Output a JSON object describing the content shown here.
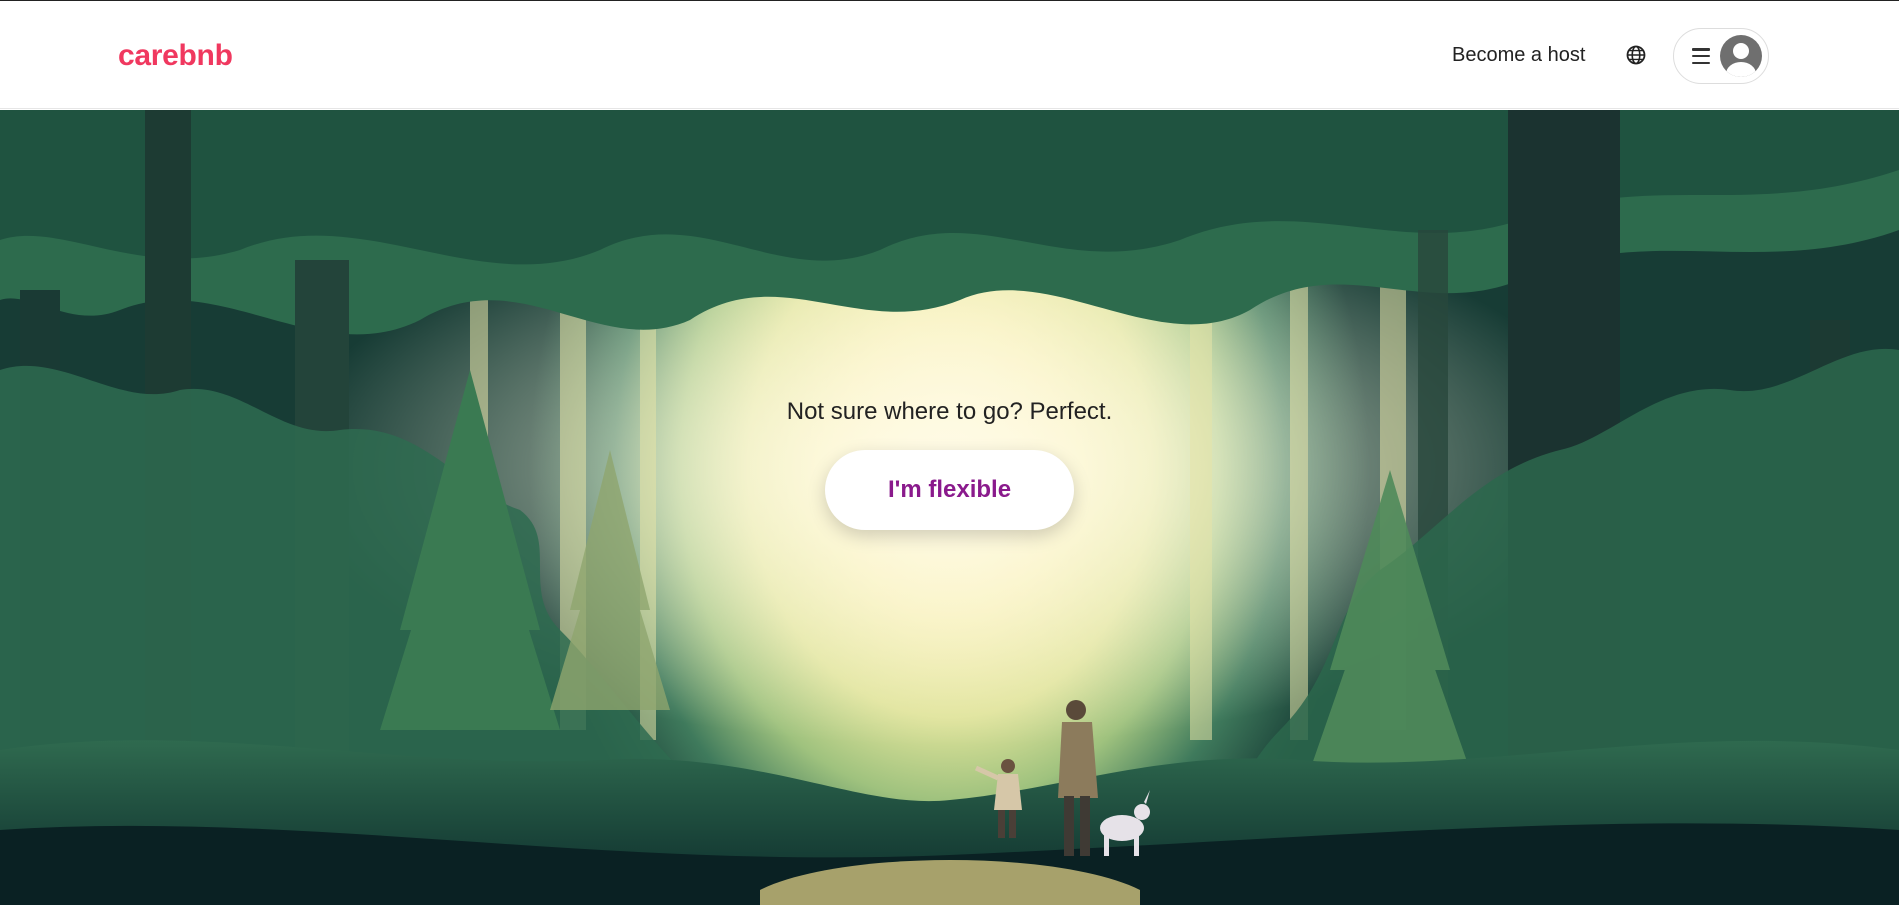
{
  "header": {
    "logo": "carebnb",
    "become_host_label": "Become a host",
    "globe_icon": "globe-icon",
    "menu_icon": "hamburger-menu-icon",
    "avatar_icon": "user-avatar-icon"
  },
  "hero": {
    "headline": "Not sure where to go? Perfect.",
    "cta_label": "I'm flexible",
    "background_image": "forest-illustration-with-adult-child-and-dog"
  },
  "colors": {
    "brand": "#f0385f",
    "cta_text": "#8a1a8c",
    "text": "#222222"
  }
}
